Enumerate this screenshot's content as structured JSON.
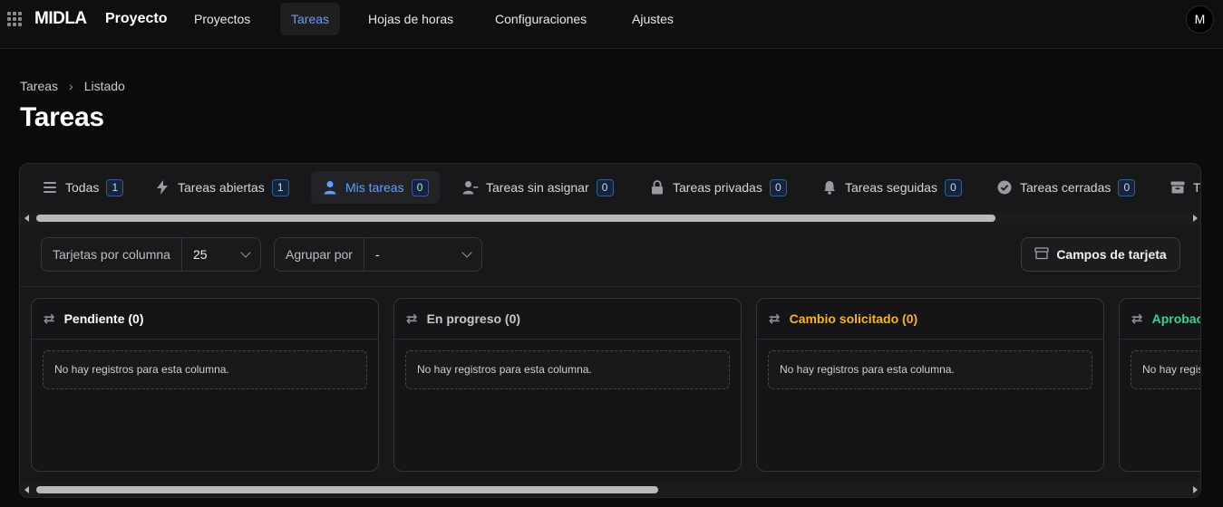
{
  "app": {
    "brand": "MIDLA",
    "project": "Proyecto",
    "avatar_initial": "M"
  },
  "nav": {
    "items": [
      {
        "label": "Proyectos",
        "active": false
      },
      {
        "label": "Tareas",
        "active": true
      },
      {
        "label": "Hojas de horas",
        "active": false
      },
      {
        "label": "Configuraciones",
        "active": false
      },
      {
        "label": "Ajustes",
        "active": false
      }
    ]
  },
  "breadcrumb": {
    "items": [
      "Tareas",
      "Listado"
    ]
  },
  "page": {
    "title": "Tareas"
  },
  "tabs": [
    {
      "label": "Todas",
      "count": "1",
      "icon": "list-icon"
    },
    {
      "label": "Tareas abiertas",
      "count": "1",
      "icon": "bolt-icon"
    },
    {
      "label": "Mis tareas",
      "count": "0",
      "icon": "user-icon",
      "active": true
    },
    {
      "label": "Tareas sin asignar",
      "count": "0",
      "icon": "user-minus-icon"
    },
    {
      "label": "Tareas privadas",
      "count": "0",
      "icon": "lock-icon"
    },
    {
      "label": "Tareas seguidas",
      "count": "0",
      "icon": "bell-icon"
    },
    {
      "label": "Tareas cerradas",
      "count": "0",
      "icon": "check-circle-icon"
    },
    {
      "label": "T",
      "count": "",
      "icon": "archive-icon"
    }
  ],
  "toolbar": {
    "cards_per_column_label": "Tarjetas por columna",
    "cards_per_column_value": "25",
    "group_by_label": "Agrupar por",
    "group_by_value": "-",
    "card_fields_label": "Campos de tarjeta"
  },
  "columns": [
    {
      "title": "Pendiente (0)",
      "color": "#ffffff",
      "empty": "No hay registros para esta columna."
    },
    {
      "title": "En progreso (0)",
      "color": "#c8c8cc",
      "empty": "No hay registros para esta columna."
    },
    {
      "title": "Cambio solicitado (0)",
      "color": "#f5b52b",
      "empty": "No hay registros para esta columna."
    },
    {
      "title": "Aprobac",
      "color": "#3ecf8e",
      "empty": "No hay regis"
    }
  ],
  "colors": {
    "accent": "#5ea0ff",
    "warning": "#f5b52b",
    "success": "#3ecf8e"
  }
}
